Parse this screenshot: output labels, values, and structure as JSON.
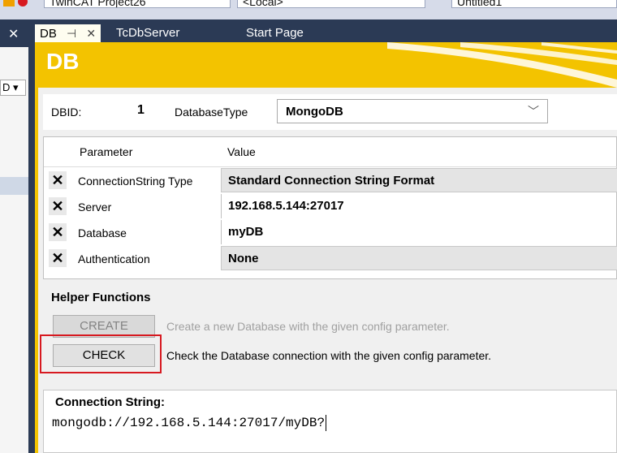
{
  "toolbar": {
    "project_combo": "TwinCAT Project26",
    "target_combo": "<Local>",
    "config_combo": "Untitled1"
  },
  "tabs": [
    {
      "label": "DB",
      "active": true,
      "pin_icon": "pin-icon",
      "close_icon": "close-icon"
    },
    {
      "label": "TcDbServer",
      "active": false
    },
    {
      "label": "Start Page",
      "active": false
    }
  ],
  "left_panel": {
    "dropdown_value": "D"
  },
  "doc": {
    "banner_title": "DB",
    "dbid_label": "DBID:",
    "dbid_value": "1",
    "database_type_label": "DatabaseType",
    "database_type_value": "MongoDB",
    "grid": {
      "headers": [
        "Parameter",
        "Value"
      ],
      "rows": [
        {
          "name": "ConnectionString Type",
          "value": "Standard Connection String Format",
          "editable_style": "dropdown"
        },
        {
          "name": "Server",
          "value": "192.168.5.144:27017",
          "editable_style": "text"
        },
        {
          "name": "Database",
          "value": "myDB",
          "editable_style": "text"
        },
        {
          "name": "Authentication",
          "value": "None",
          "editable_style": "dropdown"
        }
      ]
    },
    "helpers": {
      "title": "Helper Functions",
      "create_button": "CREATE",
      "create_desc": "Create a new Database with the given config parameter.",
      "check_button": "CHECK",
      "check_desc": "Check the Database connection with the given config parameter."
    },
    "connection": {
      "title": "Connection String:",
      "value": "mongodb://192.168.5.144:27017/myDB?"
    }
  },
  "colors": {
    "accent": "#f3c300",
    "chrome": "#2b3a55",
    "highlight": "#d71920"
  }
}
